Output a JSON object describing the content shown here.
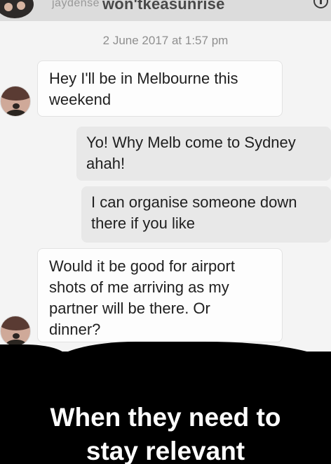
{
  "header": {
    "username": "jaydense",
    "overlay_text": "won'tkeasunrise",
    "info_icon": "info-icon"
  },
  "conversation": {
    "timestamp": "2 June 2017 at 1:57 pm",
    "messages": [
      {
        "sender": "incoming",
        "text": "Hey I'll be in Melbourne this\nweekend"
      },
      {
        "sender": "outgoing",
        "text": "Yo! Why Melb come to Sydney\nahah!"
      },
      {
        "sender": "outgoing",
        "text": "I can organise someone down\nthere if you like"
      },
      {
        "sender": "incoming",
        "text": "Would it be good for airport\nshots of me arriving as my\npartner will be there. Or\ndinner?"
      }
    ]
  },
  "caption": {
    "text": "When they need to\nstay relevant"
  },
  "colors": {
    "background": "#f4f4f4",
    "incoming_bubble": "#fdfdfd",
    "outgoing_bubble": "#e8e8e8",
    "caption_band": "#000000",
    "caption_text": "#ffffff"
  }
}
